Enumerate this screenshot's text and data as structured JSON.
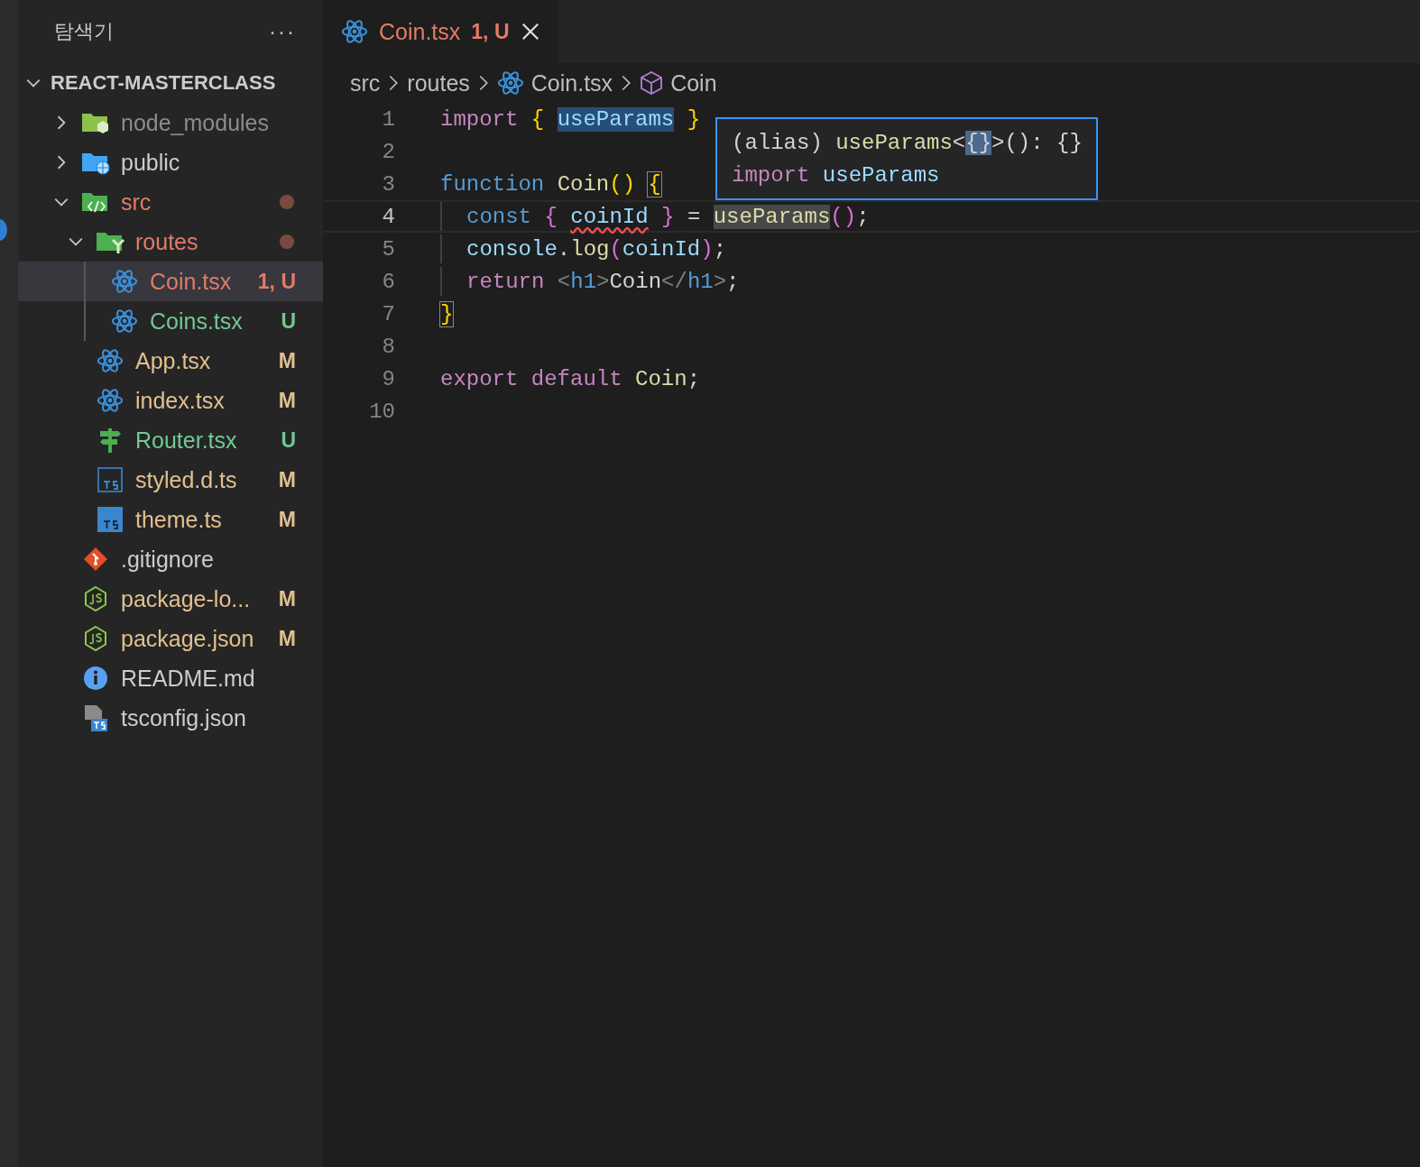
{
  "sidebar": {
    "title": "탐색기",
    "more": "···",
    "root": {
      "name": "REACT-MASTERCLASS",
      "expanded": true
    },
    "tree": [
      {
        "name": "node_modules",
        "kind": "folder-node",
        "expanded": false,
        "selected": false,
        "color": "#8c8c8c"
      },
      {
        "name": "public",
        "kind": "folder-public",
        "expanded": false,
        "selected": false,
        "color": "#cccccc"
      },
      {
        "name": "src",
        "kind": "folder-src",
        "expanded": true,
        "selected": false,
        "color": "#e27b66",
        "dot": true,
        "children": [
          {
            "name": "routes",
            "kind": "folder-routes",
            "expanded": true,
            "selected": false,
            "color": "#e27b66",
            "dot": true,
            "children": [
              {
                "name": "Coin.tsx",
                "kind": "react",
                "selected": true,
                "color": "#e27b66",
                "badge": "1, U"
              },
              {
                "name": "Coins.tsx",
                "kind": "react",
                "selected": false,
                "color": "#73c991",
                "badge": "U"
              }
            ]
          },
          {
            "name": "App.tsx",
            "kind": "react",
            "selected": false,
            "color": "#e2c08d",
            "badge": "M"
          },
          {
            "name": "index.tsx",
            "kind": "react",
            "selected": false,
            "color": "#e2c08d",
            "badge": "M"
          },
          {
            "name": "Router.tsx",
            "kind": "router",
            "selected": false,
            "color": "#73c991",
            "badge": "U"
          },
          {
            "name": "styled.d.ts",
            "kind": "ts-outline",
            "selected": false,
            "color": "#e2c08d",
            "badge": "M"
          },
          {
            "name": "theme.ts",
            "kind": "ts",
            "selected": false,
            "color": "#e2c08d",
            "badge": "M"
          }
        ]
      },
      {
        "name": ".gitignore",
        "kind": "git",
        "selected": false,
        "color": "#cccccc"
      },
      {
        "name": "package-lo...",
        "kind": "node",
        "selected": false,
        "color": "#e2c08d",
        "badge": "M"
      },
      {
        "name": "package.json",
        "kind": "node",
        "selected": false,
        "color": "#e2c08d",
        "badge": "M"
      },
      {
        "name": "README.md",
        "kind": "info",
        "selected": false,
        "color": "#cccccc"
      },
      {
        "name": "tsconfig.json",
        "kind": "tsconfig",
        "selected": false,
        "color": "#cccccc"
      }
    ]
  },
  "tabs": [
    {
      "label": "Coin.tsx",
      "badge": "1, U",
      "selected": true,
      "color": "#e27b66"
    }
  ],
  "breadcrumbs": [
    {
      "label": "src",
      "kind": "folder"
    },
    {
      "label": "routes",
      "kind": "folder"
    },
    {
      "label": "Coin.tsx",
      "kind": "react"
    },
    {
      "label": "Coin",
      "kind": "cube"
    }
  ],
  "code": [
    {
      "number": "1",
      "current": false,
      "indented": false,
      "tokens": [
        {
          "text": "import ",
          "kind": "keyword"
        },
        {
          "text": "{ ",
          "kind": "brace"
        },
        {
          "text": "useParams",
          "kind": "var",
          "highlighted": true
        },
        {
          "text": " }",
          "kind": "brace"
        }
      ]
    },
    {
      "number": "2",
      "current": false,
      "indented": false
    },
    {
      "number": "3",
      "current": false,
      "indented": false,
      "tokens": [
        {
          "text": "function ",
          "kind": "storage"
        },
        {
          "text": "Coin",
          "kind": "func"
        },
        {
          "text": "() ",
          "kind": "brace"
        },
        {
          "text": "{",
          "kind": "brace",
          "boxed": true
        }
      ]
    },
    {
      "number": "4",
      "current": true,
      "indented": true,
      "tokens": [
        {
          "text": "const ",
          "kind": "storage"
        },
        {
          "text": "{ ",
          "kind": "brace2"
        },
        {
          "text": "coinId",
          "kind": "var",
          "squiggle": true
        },
        {
          "text": " } ",
          "kind": "brace2"
        },
        {
          "text": "= ",
          "kind": "punct"
        },
        {
          "text": "useParams",
          "kind": "func",
          "shaded": true
        },
        {
          "text": "()",
          "kind": "brace2"
        },
        {
          "text": ";",
          "kind": "punct"
        }
      ]
    },
    {
      "number": "5",
      "current": false,
      "indented": true,
      "tokens": [
        {
          "text": "console",
          "kind": "var"
        },
        {
          "text": ".",
          "kind": "punct"
        },
        {
          "text": "log",
          "kind": "func"
        },
        {
          "text": "(",
          "kind": "brace2"
        },
        {
          "text": "coinId",
          "kind": "var"
        },
        {
          "text": ")",
          "kind": "brace2"
        },
        {
          "text": ";",
          "kind": "punct"
        }
      ]
    },
    {
      "number": "6",
      "current": false,
      "indented": true,
      "tokens": [
        {
          "text": "return ",
          "kind": "keyword"
        },
        {
          "text": "<",
          "kind": "tag"
        },
        {
          "text": "h1",
          "kind": "tagname"
        },
        {
          "text": ">",
          "kind": "tag"
        },
        {
          "text": "Coin",
          "kind": "plain"
        },
        {
          "text": "</",
          "kind": "tag"
        },
        {
          "text": "h1",
          "kind": "tagname"
        },
        {
          "text": ">",
          "kind": "tag"
        },
        {
          "text": ";",
          "kind": "punct"
        }
      ]
    },
    {
      "number": "7",
      "current": false,
      "indented": false,
      "tokens": [
        {
          "text": "}",
          "kind": "brace",
          "boxed": true
        }
      ]
    },
    {
      "number": "8",
      "current": false,
      "indented": false
    },
    {
      "number": "9",
      "current": false,
      "indented": false,
      "tokens": [
        {
          "text": "export default ",
          "kind": "keyword"
        },
        {
          "text": "Coin",
          "kind": "func"
        },
        {
          "text": ";",
          "kind": "punct"
        }
      ]
    },
    {
      "number": "10",
      "current": false,
      "indented": false
    }
  ],
  "hover": {
    "lines": [
      [
        {
          "text": "(alias) ",
          "kind": "plain"
        },
        {
          "text": "useParams",
          "kind": "func"
        },
        {
          "text": "<",
          "kind": "plain"
        },
        {
          "text": "{}",
          "kind": "plain",
          "highlighted": true
        },
        {
          "text": ">(): {}",
          "kind": "plain"
        }
      ],
      [
        {
          "text": "import ",
          "kind": "keyword"
        },
        {
          "text": "useParams",
          "kind": "var"
        }
      ]
    ]
  }
}
